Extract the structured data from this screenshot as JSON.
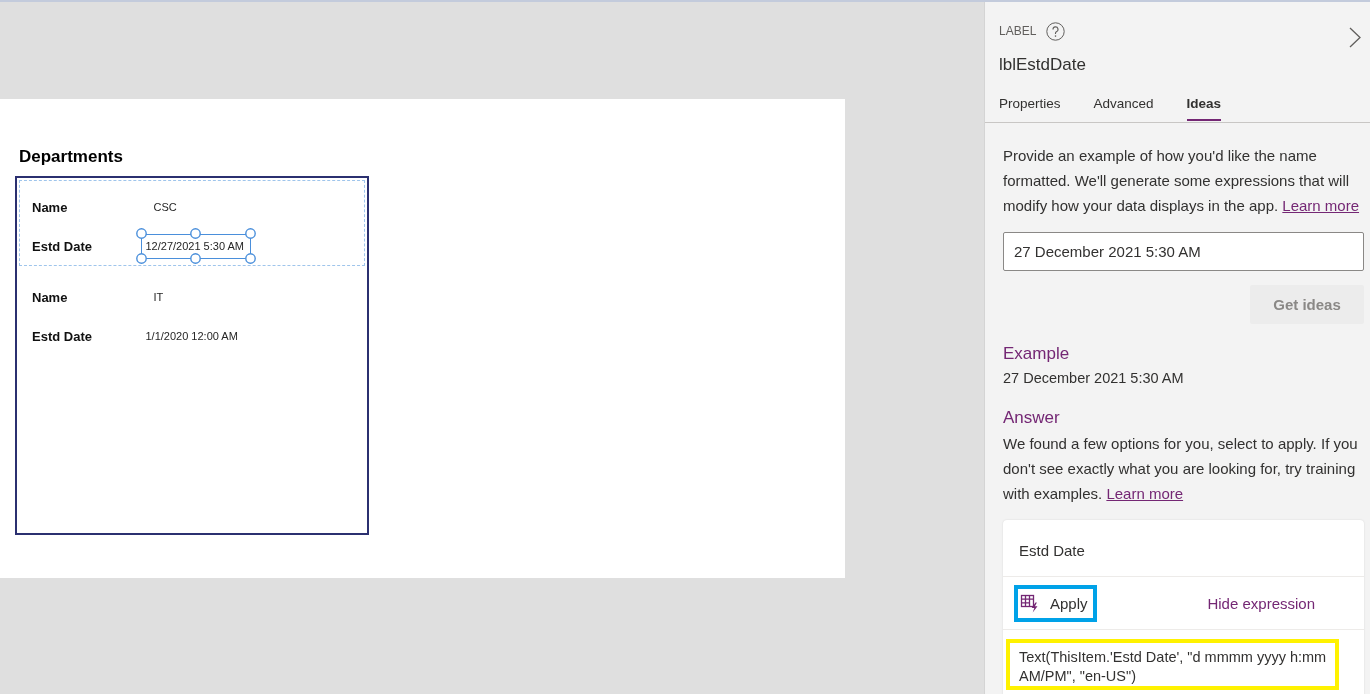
{
  "canvas": {
    "screen": {
      "title": "Departments",
      "gallery": {
        "items": [
          {
            "selected": true,
            "fields": [
              {
                "kind": "text",
                "label": "Name",
                "value": "CSC",
                "selected": false
              },
              {
                "kind": "date",
                "label": "Estd Date",
                "value": "12/27/2021 5:30 AM",
                "selected": true
              }
            ]
          },
          {
            "selected": false,
            "fields": [
              {
                "kind": "text",
                "label": "Name",
                "value": "IT",
                "selected": false
              },
              {
                "kind": "date",
                "label": "Estd Date",
                "value": "1/1/2020 12:00 AM",
                "selected": false
              }
            ]
          }
        ]
      }
    }
  },
  "panel": {
    "control_type": "LABEL",
    "control_name": "lblEstdDate",
    "tabs": [
      {
        "label": "Properties",
        "selected": false
      },
      {
        "label": "Advanced",
        "selected": false
      },
      {
        "label": "Ideas",
        "selected": true
      }
    ],
    "intro": {
      "text": "Provide an example of how you'd like the name formatted. We'll generate some expressions that will modify how your data displays in the app.",
      "link": "Learn more"
    },
    "example_input": {
      "value": "27 December 2021 5:30 AM"
    },
    "get_ideas_button": {
      "label": "Get ideas",
      "disabled": true
    },
    "example": {
      "heading": "Example",
      "text": "27 December 2021 5:30 AM"
    },
    "answer": {
      "heading": "Answer",
      "text": "We found a few options for you, select to apply. If you don't see exactly what you are looking for, try training with examples.",
      "link": "Learn more"
    },
    "suggestion": {
      "title": "Estd Date",
      "apply_button": {
        "label": "Apply",
        "highlighted": true
      },
      "toggle_link": "Hide expression",
      "expression": {
        "text": "Text(ThisItem.'Estd Date', \"d mmmm yyyy h:mm AM/PM\", \"en-US\")",
        "highlighted": true
      }
    }
  }
}
